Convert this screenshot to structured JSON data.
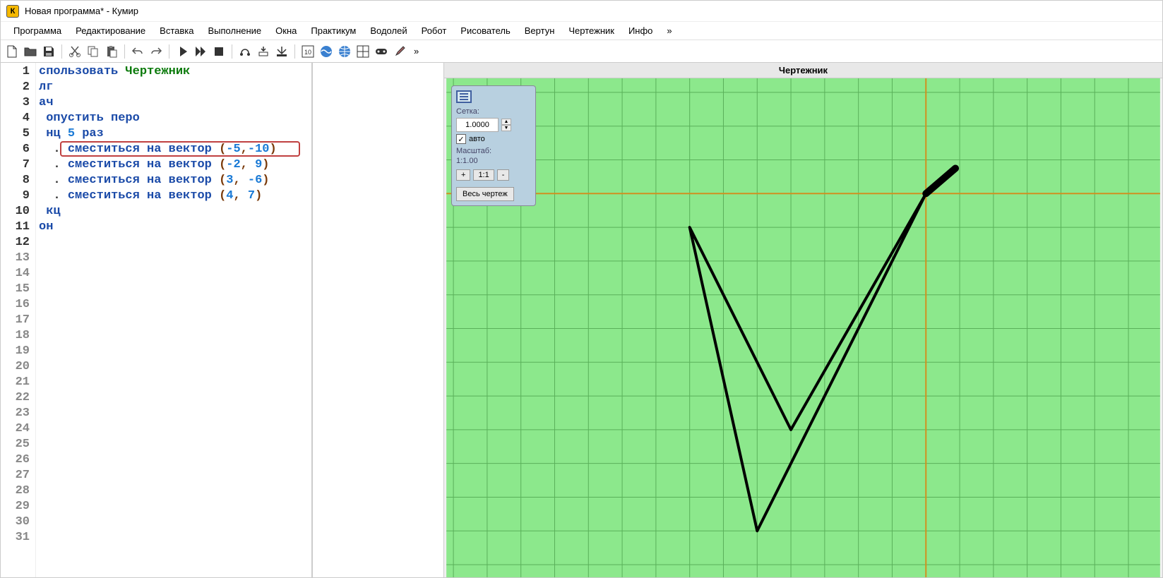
{
  "title": "Новая программа* - Кумир",
  "app_icon_letter": "К",
  "menu": [
    "Программа",
    "Редактирование",
    "Вставка",
    "Выполнение",
    "Окна",
    "Практикум",
    "Водолей",
    "Робот",
    "Рисователь",
    "Вертун",
    "Чертежник",
    "Инфо",
    "»"
  ],
  "toolbar_more": "»",
  "canvas_title": "Чертежник",
  "gutter": {
    "lines": 31,
    "active_max": 12
  },
  "code": {
    "l1_a": "спользовать ",
    "l1_b": "Чертежник",
    "l2": "лг",
    "l3": "ач",
    "l4": " опустить перо",
    "l5_a": " нц ",
    "l5_b": "5",
    "l5_c": " раз",
    "l6_a": "сместиться на вектор ",
    "l6_b": "(",
    "l6_c": "-5",
    "l6_d": ",",
    "l6_e": "-10",
    "l6_f": ")",
    "l7_a": "сместиться на вектор ",
    "l7_b": "(",
    "l7_c": "-2",
    "l7_d": ", ",
    "l7_e": "9",
    "l7_f": ")",
    "l8_a": "сместиться на вектор ",
    "l8_b": "(",
    "l8_c": "3",
    "l8_d": ", ",
    "l8_e": "-6",
    "l8_f": ")",
    "l9_a": "сместиться на вектор ",
    "l9_b": "(",
    "l9_c": "4",
    "l9_d": ", ",
    "l9_e": "7",
    "l9_f": ")",
    "l10": " кц",
    "l11": "он",
    "dot": ". "
  },
  "panel": {
    "grid_label": "Сетка:",
    "grid_value": "1.0000",
    "auto_label": "авто",
    "auto_checked": "✓",
    "scale_label": "Масштаб:",
    "scale_value": "1:1.00",
    "plus": "+",
    "ratio": "1:1",
    "minus": "-",
    "full": "Весь чертеж"
  }
}
